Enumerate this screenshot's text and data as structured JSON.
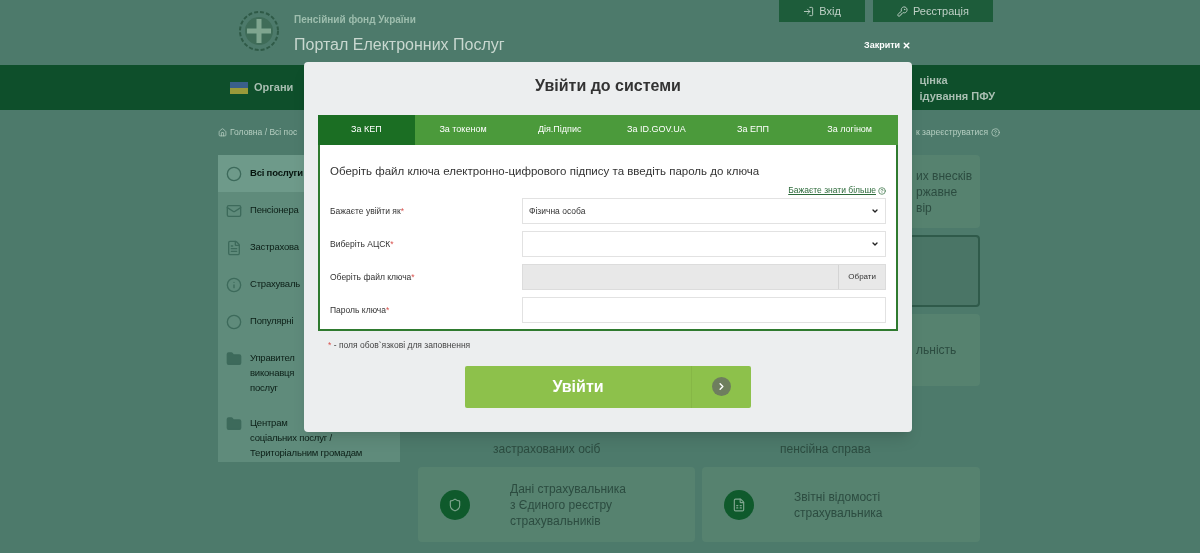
{
  "header": {
    "org_name": "Пенсійний фонд України",
    "portal_name": "Портал Електронних Послуг",
    "buttons": [
      {
        "label": "Вхід",
        "kind": "login"
      },
      {
        "label": "Реєстрація",
        "kind": "register"
      }
    ]
  },
  "nav": {
    "left_label": "Органи",
    "right_lines": [
      "цінка",
      "ідування ПФУ"
    ]
  },
  "breadcrumb": {
    "text": "Головна / Всі пос",
    "register_hint": "к зареєструватися"
  },
  "sidebar": {
    "items": [
      {
        "lines": [
          "Всі послуги"
        ],
        "kind": "circle",
        "selected": true
      },
      {
        "lines": [
          "Пенсіонера"
        ],
        "kind": "mail",
        "selected": false
      },
      {
        "lines": [
          "Застрахова"
        ],
        "kind": "doc",
        "selected": false
      },
      {
        "lines": [
          "Страхуваль"
        ],
        "kind": "info",
        "selected": false
      },
      {
        "lines": [
          "Популярні"
        ],
        "kind": "circle",
        "selected": false
      },
      {
        "lines": [
          "Управител",
          "виконавця",
          "послуг"
        ],
        "kind": "folder",
        "selected": false
      },
      {
        "lines": [
          "Центрам",
          "соціальних послуг /",
          "Територіальним громадам"
        ],
        "kind": "folder",
        "selected": false
      }
    ]
  },
  "cards": [
    {
      "lines": [
        "их внесків",
        "ржавне",
        "вір"
      ],
      "highlighted": false
    },
    {
      "highlighted": true
    },
    {
      "lines": [
        "льність"
      ],
      "highlighted": false
    },
    {
      "lines": [
        "Дані страхувальника",
        "з Єдиного реєстру",
        "страхувальників"
      ],
      "highlighted": false,
      "kind": "shield"
    },
    {
      "lines": [
        "Звітні відомості",
        "страхувальника"
      ],
      "highlighted": false,
      "kind": "report"
    }
  ],
  "partial_card_texts": [
    "застрахованих осіб",
    "пенсійна справа"
  ],
  "modal": {
    "close_label": "Закрити",
    "title": "Увійти до системи",
    "tabs": [
      {
        "label": "За КЕП",
        "selected": true
      },
      {
        "label": "За токеном",
        "selected": false
      },
      {
        "label": "Дія.Підпис",
        "selected": false
      },
      {
        "label": "За ID.GOV.UA",
        "selected": false
      },
      {
        "label": "За ЕПП",
        "selected": false
      },
      {
        "label": "За логіном",
        "selected": false
      }
    ],
    "heading": "Оберіть файл ключа електронно-цифрового підпису та введіть пароль до ключа",
    "more_link": "Бажаєте знати більше",
    "fields": [
      {
        "label": "Бажаєте увійти як",
        "kind": "select",
        "value": "Фізична особа"
      },
      {
        "label": "Виберіть АЦСК",
        "kind": "select"
      },
      {
        "label": "Оберіть файл ключа",
        "kind": "file",
        "button": "Обрати"
      },
      {
        "label": "Пароль ключа",
        "kind": "password"
      }
    ],
    "required_mark": "*",
    "required_note": "- поля обов`язкові для заповнення",
    "submit": "Увійти"
  }
}
